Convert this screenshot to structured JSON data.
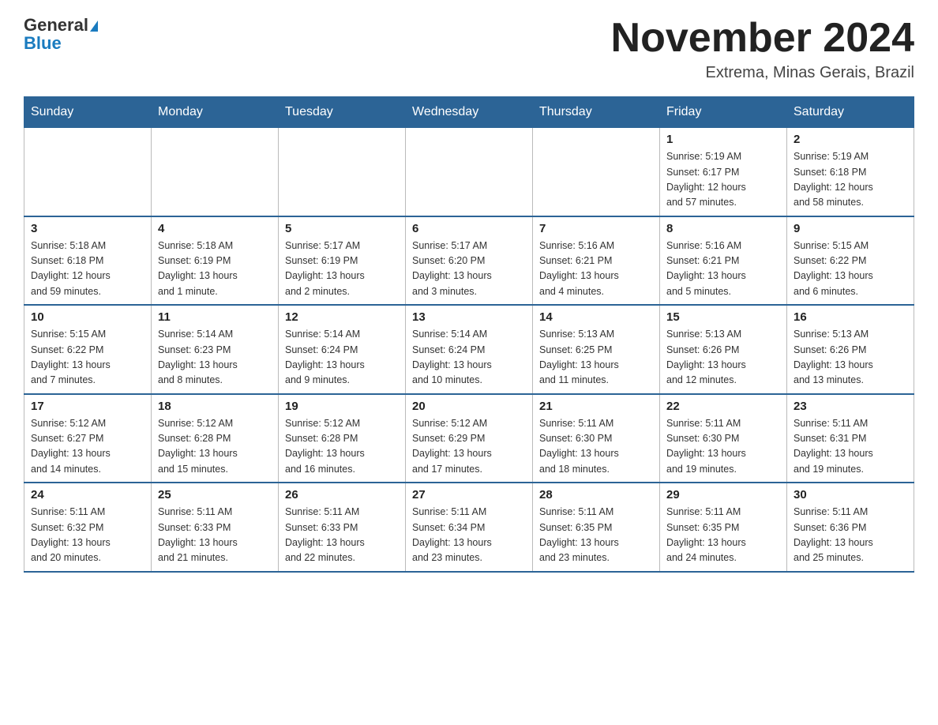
{
  "header": {
    "logo_line1": "General",
    "logo_line2": "Blue",
    "month_title": "November 2024",
    "subtitle": "Extrema, Minas Gerais, Brazil"
  },
  "weekdays": [
    "Sunday",
    "Monday",
    "Tuesday",
    "Wednesday",
    "Thursday",
    "Friday",
    "Saturday"
  ],
  "weeks": [
    [
      {
        "day": "",
        "info": ""
      },
      {
        "day": "",
        "info": ""
      },
      {
        "day": "",
        "info": ""
      },
      {
        "day": "",
        "info": ""
      },
      {
        "day": "",
        "info": ""
      },
      {
        "day": "1",
        "info": "Sunrise: 5:19 AM\nSunset: 6:17 PM\nDaylight: 12 hours\nand 57 minutes."
      },
      {
        "day": "2",
        "info": "Sunrise: 5:19 AM\nSunset: 6:18 PM\nDaylight: 12 hours\nand 58 minutes."
      }
    ],
    [
      {
        "day": "3",
        "info": "Sunrise: 5:18 AM\nSunset: 6:18 PM\nDaylight: 12 hours\nand 59 minutes."
      },
      {
        "day": "4",
        "info": "Sunrise: 5:18 AM\nSunset: 6:19 PM\nDaylight: 13 hours\nand 1 minute."
      },
      {
        "day": "5",
        "info": "Sunrise: 5:17 AM\nSunset: 6:19 PM\nDaylight: 13 hours\nand 2 minutes."
      },
      {
        "day": "6",
        "info": "Sunrise: 5:17 AM\nSunset: 6:20 PM\nDaylight: 13 hours\nand 3 minutes."
      },
      {
        "day": "7",
        "info": "Sunrise: 5:16 AM\nSunset: 6:21 PM\nDaylight: 13 hours\nand 4 minutes."
      },
      {
        "day": "8",
        "info": "Sunrise: 5:16 AM\nSunset: 6:21 PM\nDaylight: 13 hours\nand 5 minutes."
      },
      {
        "day": "9",
        "info": "Sunrise: 5:15 AM\nSunset: 6:22 PM\nDaylight: 13 hours\nand 6 minutes."
      }
    ],
    [
      {
        "day": "10",
        "info": "Sunrise: 5:15 AM\nSunset: 6:22 PM\nDaylight: 13 hours\nand 7 minutes."
      },
      {
        "day": "11",
        "info": "Sunrise: 5:14 AM\nSunset: 6:23 PM\nDaylight: 13 hours\nand 8 minutes."
      },
      {
        "day": "12",
        "info": "Sunrise: 5:14 AM\nSunset: 6:24 PM\nDaylight: 13 hours\nand 9 minutes."
      },
      {
        "day": "13",
        "info": "Sunrise: 5:14 AM\nSunset: 6:24 PM\nDaylight: 13 hours\nand 10 minutes."
      },
      {
        "day": "14",
        "info": "Sunrise: 5:13 AM\nSunset: 6:25 PM\nDaylight: 13 hours\nand 11 minutes."
      },
      {
        "day": "15",
        "info": "Sunrise: 5:13 AM\nSunset: 6:26 PM\nDaylight: 13 hours\nand 12 minutes."
      },
      {
        "day": "16",
        "info": "Sunrise: 5:13 AM\nSunset: 6:26 PM\nDaylight: 13 hours\nand 13 minutes."
      }
    ],
    [
      {
        "day": "17",
        "info": "Sunrise: 5:12 AM\nSunset: 6:27 PM\nDaylight: 13 hours\nand 14 minutes."
      },
      {
        "day": "18",
        "info": "Sunrise: 5:12 AM\nSunset: 6:28 PM\nDaylight: 13 hours\nand 15 minutes."
      },
      {
        "day": "19",
        "info": "Sunrise: 5:12 AM\nSunset: 6:28 PM\nDaylight: 13 hours\nand 16 minutes."
      },
      {
        "day": "20",
        "info": "Sunrise: 5:12 AM\nSunset: 6:29 PM\nDaylight: 13 hours\nand 17 minutes."
      },
      {
        "day": "21",
        "info": "Sunrise: 5:11 AM\nSunset: 6:30 PM\nDaylight: 13 hours\nand 18 minutes."
      },
      {
        "day": "22",
        "info": "Sunrise: 5:11 AM\nSunset: 6:30 PM\nDaylight: 13 hours\nand 19 minutes."
      },
      {
        "day": "23",
        "info": "Sunrise: 5:11 AM\nSunset: 6:31 PM\nDaylight: 13 hours\nand 19 minutes."
      }
    ],
    [
      {
        "day": "24",
        "info": "Sunrise: 5:11 AM\nSunset: 6:32 PM\nDaylight: 13 hours\nand 20 minutes."
      },
      {
        "day": "25",
        "info": "Sunrise: 5:11 AM\nSunset: 6:33 PM\nDaylight: 13 hours\nand 21 minutes."
      },
      {
        "day": "26",
        "info": "Sunrise: 5:11 AM\nSunset: 6:33 PM\nDaylight: 13 hours\nand 22 minutes."
      },
      {
        "day": "27",
        "info": "Sunrise: 5:11 AM\nSunset: 6:34 PM\nDaylight: 13 hours\nand 23 minutes."
      },
      {
        "day": "28",
        "info": "Sunrise: 5:11 AM\nSunset: 6:35 PM\nDaylight: 13 hours\nand 23 minutes."
      },
      {
        "day": "29",
        "info": "Sunrise: 5:11 AM\nSunset: 6:35 PM\nDaylight: 13 hours\nand 24 minutes."
      },
      {
        "day": "30",
        "info": "Sunrise: 5:11 AM\nSunset: 6:36 PM\nDaylight: 13 hours\nand 25 minutes."
      }
    ]
  ]
}
